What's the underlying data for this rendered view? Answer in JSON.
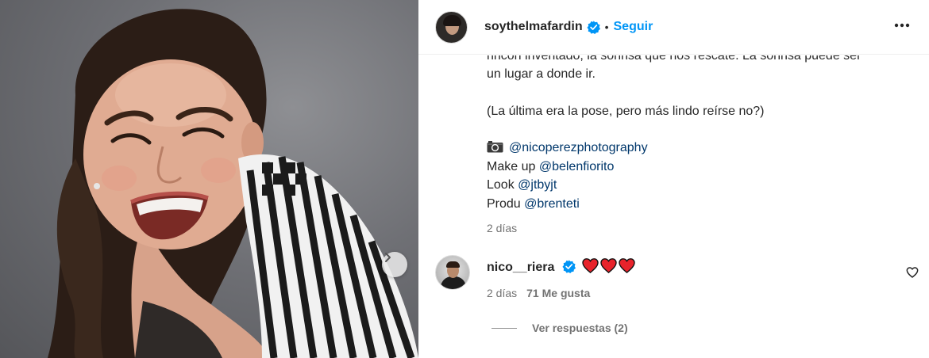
{
  "post": {
    "username": "soythelmafardin",
    "follow_label": "Seguir",
    "separator": "•",
    "caption": {
      "clipped_line": "rincón inventado, la sonrisa que nos rescate. La sonrisa puede ser",
      "line2": "un lugar a donde ir.",
      "line3": "(La última era la pose, pero más lindo reírse no?)",
      "credit_photo_mention": "@nicoperezphotography",
      "makeup_label": "Make up",
      "makeup_mention": "@belenfiorito",
      "look_label": "Look",
      "look_mention": "@jtbyjt",
      "produ_label": "Produ",
      "produ_mention": "@brenteti"
    },
    "time": "2 días"
  },
  "comment": {
    "username": "nico__riera",
    "time": "2 días",
    "likes": "71 Me gusta",
    "replies_label": "Ver respuestas (2)",
    "hearts_count": 3
  },
  "icons": {
    "verified": "verified-badge-icon",
    "more": "more-options-icon",
    "next": "chevron-right-icon",
    "camera": "camera-icon",
    "like": "heart-outline-icon"
  },
  "colors": {
    "accent": "#0095f6",
    "mention": "#00376b",
    "secondary_text": "#737373",
    "heart": "#ed4956"
  }
}
